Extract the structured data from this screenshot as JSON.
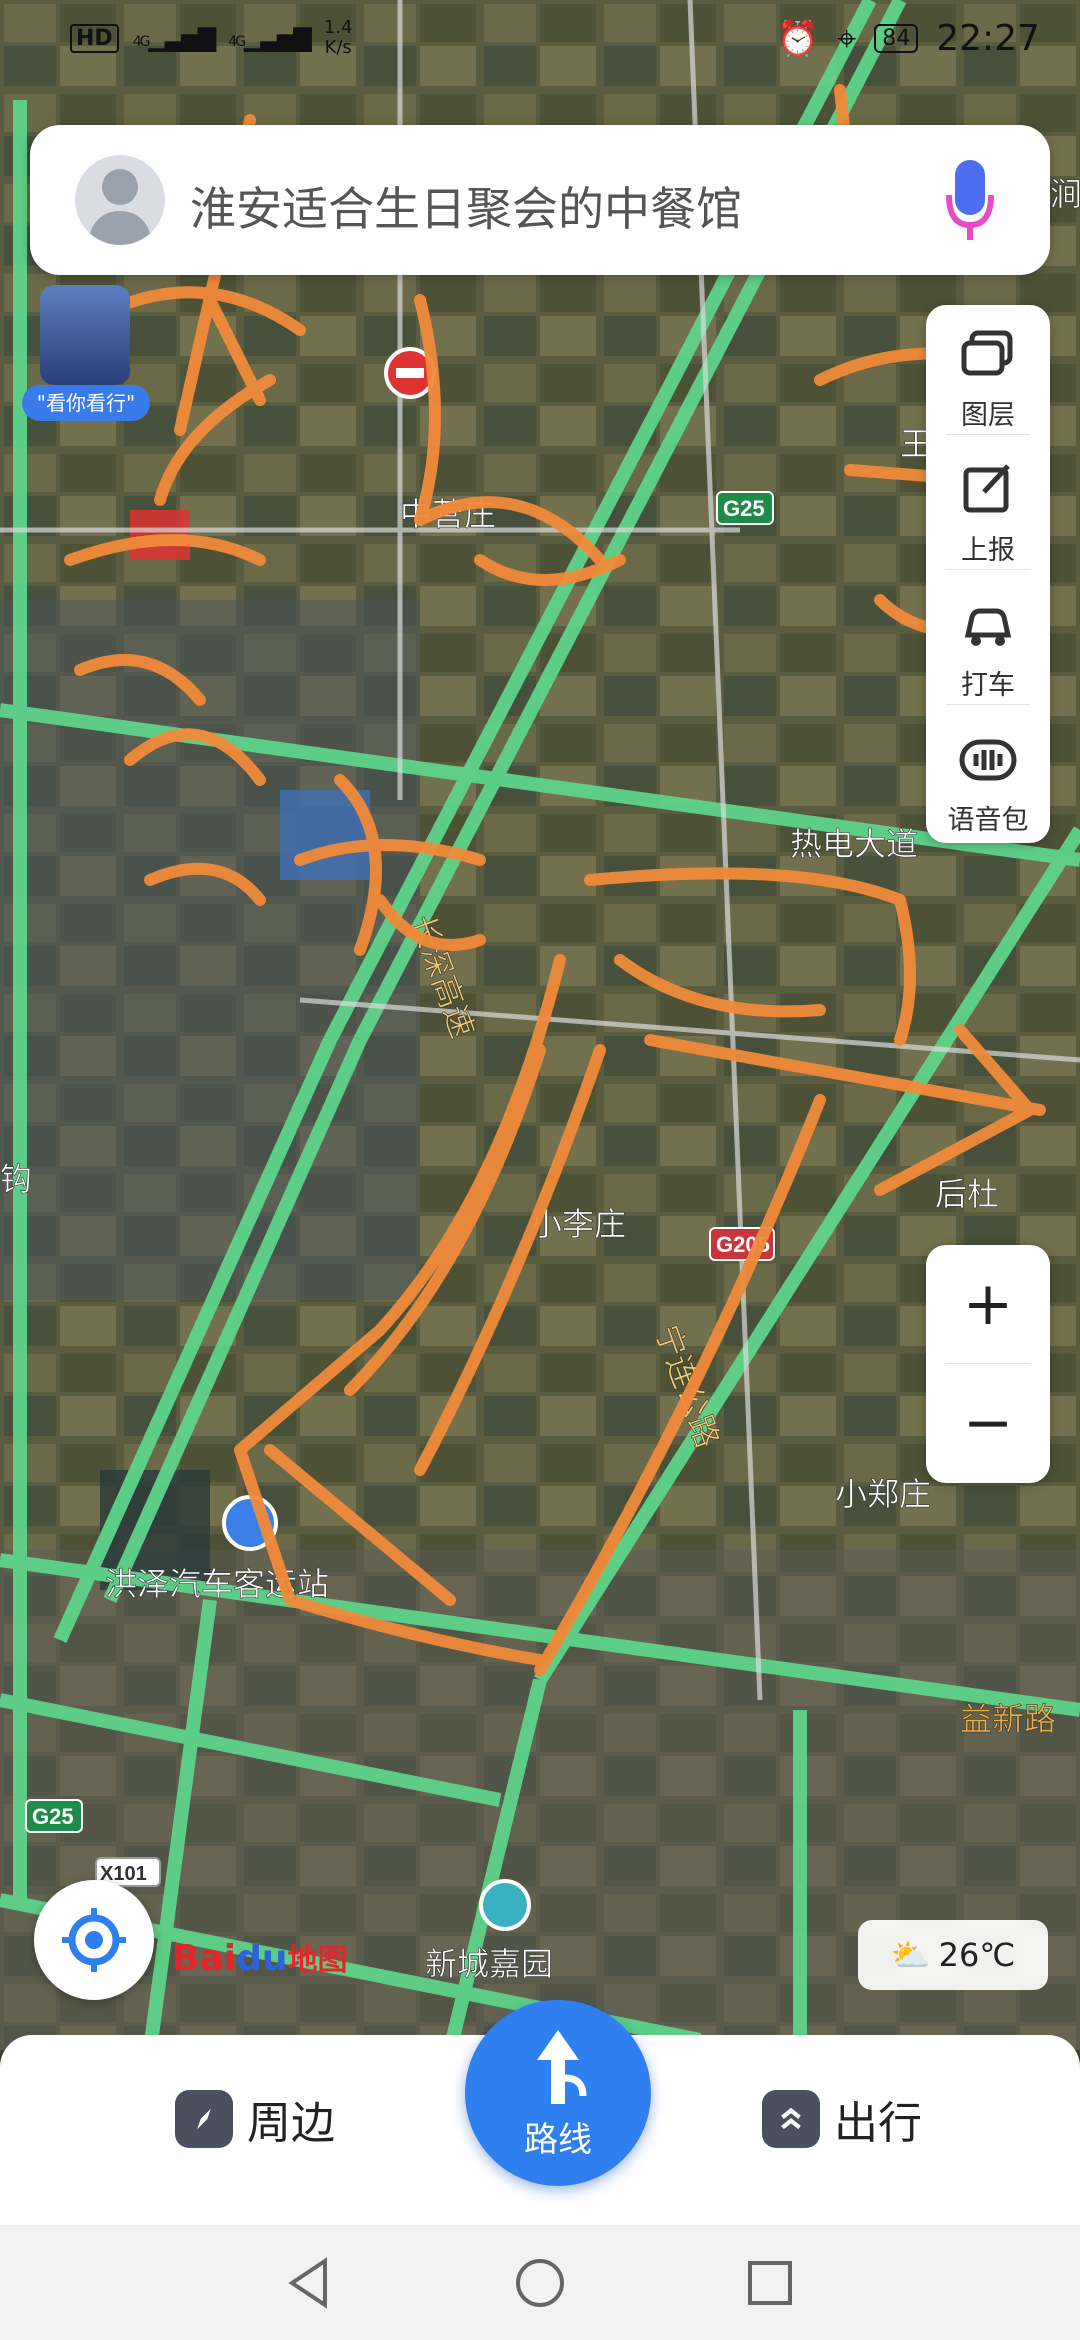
{
  "status_bar": {
    "hd": "HD",
    "signal1": "4G",
    "signal2": "4G",
    "speed_value": "1.4",
    "speed_unit": "K/s",
    "battery": "84",
    "time": "22:27"
  },
  "search": {
    "placeholder": "淮安适合生日聚会的中餐馆"
  },
  "promo": {
    "tag": "\"看你看行\""
  },
  "tools": [
    {
      "label": "图层"
    },
    {
      "label": "上报"
    },
    {
      "label": "打车"
    },
    {
      "label": "语音包"
    }
  ],
  "map_labels": {
    "l1": "中营庄",
    "l2": "G25",
    "l3": "王",
    "l4": "热电大道",
    "l5": "长深高速",
    "l6": "小李庄",
    "l7": "G205",
    "l8": "后杜",
    "l9": "宁连公路",
    "l10": "小郑庄",
    "l11": "洪泽汽车客运站",
    "l12": "益新路",
    "l13": "G25",
    "l14": "X101",
    "l15": "新城嘉园",
    "l16": "钩",
    "l17": "涧"
  },
  "zoom": {
    "in": "+",
    "out": "−"
  },
  "logo": {
    "bai": "Bai",
    "du": "du",
    "ditu": "地图"
  },
  "weather": {
    "temp": "26℃"
  },
  "bottom_nav": {
    "nearby": "周边",
    "route": "路线",
    "travel": "出行"
  },
  "colors": {
    "route_blue": "#2f7ff0",
    "road_green": "#5ed48a",
    "scribble_orange": "#f08a3a"
  }
}
